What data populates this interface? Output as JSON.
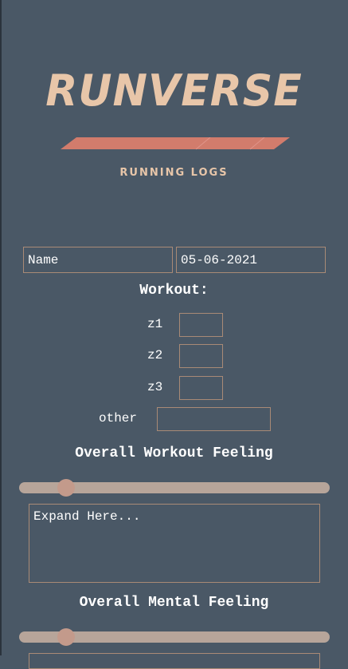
{
  "brand": {
    "title": "RUNVERSE",
    "subtitle": "RUNNING LOGS",
    "stripe_color": "#d27c6c",
    "title_color": "#e8c6a9"
  },
  "form": {
    "name": {
      "placeholder": "Name",
      "value": ""
    },
    "date": {
      "value": "05-06-2021"
    },
    "workout": {
      "title": "Workout:",
      "zones": [
        {
          "label": "z1",
          "value": ""
        },
        {
          "label": "z2",
          "value": ""
        },
        {
          "label": "z3",
          "value": ""
        }
      ],
      "other": {
        "label": "other",
        "value": ""
      }
    },
    "workout_feeling": {
      "title": "Overall Workout Feeling",
      "slider_value": 0.12,
      "notes_placeholder": "Expand Here..."
    },
    "mental_feeling": {
      "title": "Overall Mental Feeling",
      "slider_value": 0.12
    }
  },
  "colors": {
    "background": "#4a5866",
    "field_border": "#a98a76",
    "slider_track": "#b7a59a",
    "slider_thumb": "#c39a8b"
  }
}
